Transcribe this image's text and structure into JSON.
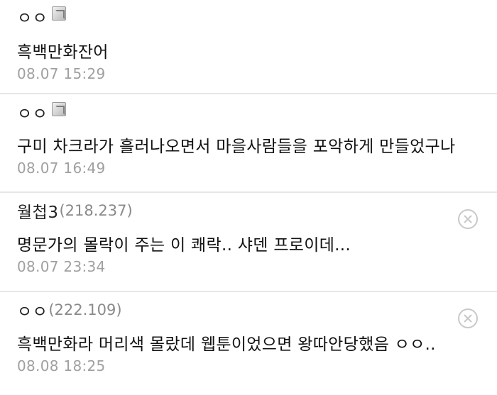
{
  "comments": [
    {
      "author": "ㅇㅇ",
      "ip": "",
      "member_icon": "member-badge-icon",
      "text": "흑백만화잔어",
      "date": "08.07 15:29",
      "deletable": false
    },
    {
      "author": "ㅇㅇ",
      "ip": "",
      "member_icon": "member-badge-icon",
      "text": "구미 차크라가 흘러나오면서 마을사람들을 포악하게 만들었구나",
      "date": "08.07 16:49",
      "deletable": false
    },
    {
      "author": "월첩3",
      "ip": "(218.237)",
      "text": "명문가의 몰락이 주는 이 쾌락.. 샤덴 프로이데...",
      "date": "08.07 23:34",
      "deletable": true
    },
    {
      "author": "ㅇㅇ",
      "ip": "(222.109)",
      "text": "흑백만화라 머리색 몰랐데 웹툰이었으면 왕따안당했음 ㅇㅇ..",
      "date": "08.08 18:25",
      "deletable": true
    }
  ],
  "colors": {
    "divider": "#e7e7e7",
    "meta": "#a0a0a0",
    "ip": "#8a8a8a",
    "delete_icon": "#c9c9c9"
  }
}
